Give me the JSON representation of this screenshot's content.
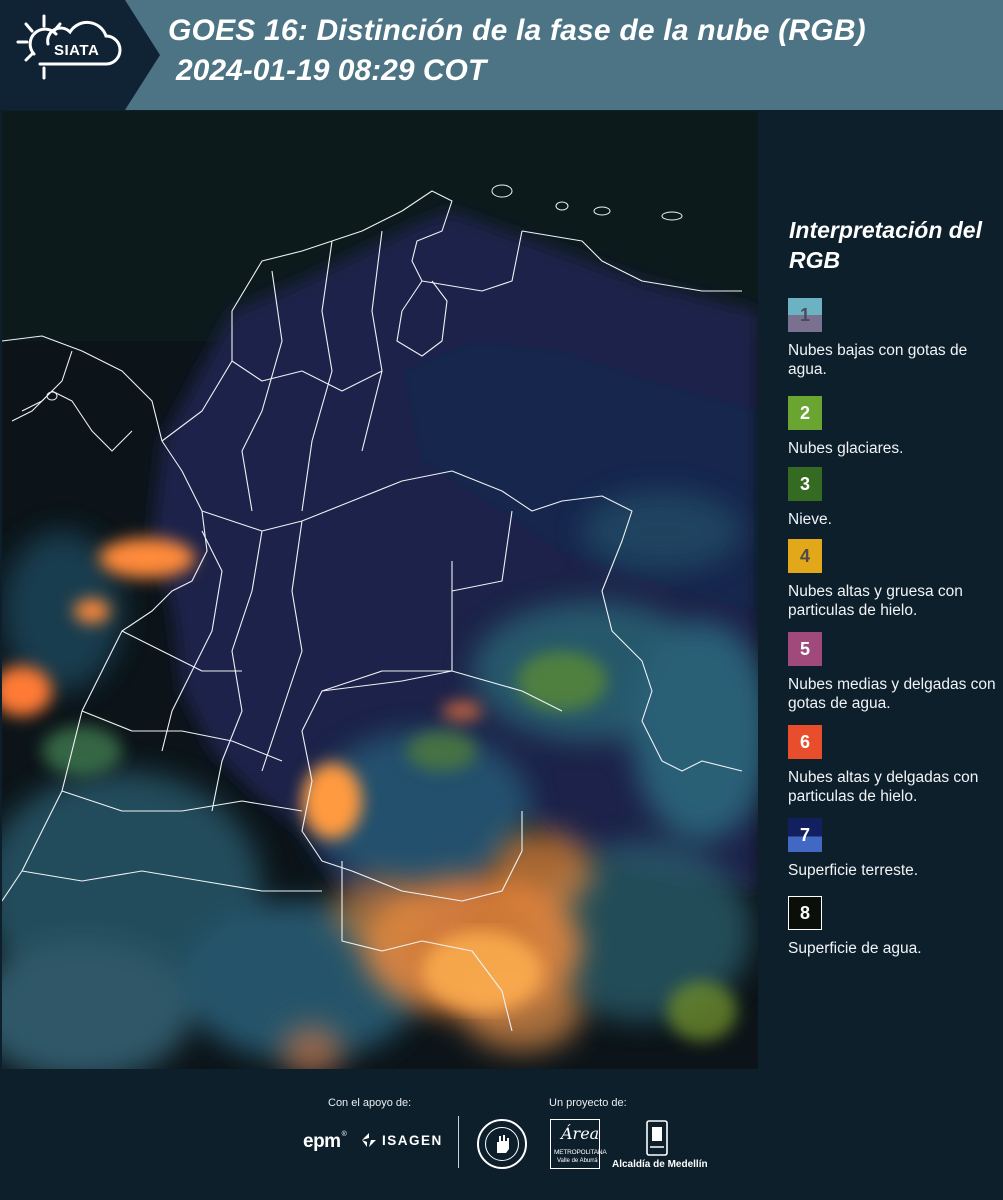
{
  "header": {
    "logo_text": "SIATA",
    "title_line1": "GOES 16: Distinción de la fase de la nube (RGB)",
    "title_line2": "2024-01-19 08:29 COT"
  },
  "legend": {
    "title": "Interpretación del RGB",
    "items": [
      {
        "number": "1",
        "label": "Nubes bajas con gotas de agua.",
        "color_top": "#6bb3c2",
        "color_bottom": "#7a7090",
        "text_color": "#4a4a5c"
      },
      {
        "number": "2",
        "label": "Nubes glaciares.",
        "color_top": "#6aa531",
        "color_bottom": "#6aa531",
        "text_color": "#ffffff"
      },
      {
        "number": "3",
        "label": "Nieve.",
        "color_top": "#356a22",
        "color_bottom": "#356a22",
        "text_color": "#ffffff"
      },
      {
        "number": "4",
        "label": "Nubes altas y gruesa con particulas de hielo.",
        "color_top": "#e3a819",
        "color_bottom": "#e3a819",
        "text_color": "#4a4a4a"
      },
      {
        "number": "5",
        "label": "Nubes medias y delgadas con gotas de agua.",
        "color_top": "#a04a7c",
        "color_bottom": "#a04a7c",
        "text_color": "#ffffff"
      },
      {
        "number": "6",
        "label": "Nubes altas y delgadas con particulas de hielo.",
        "color_top": "#e84e2c",
        "color_bottom": "#e84e2c",
        "text_color": "#ffffff"
      },
      {
        "number": "7",
        "label": "Superficie terreste.",
        "color_top": "#13205f",
        "color_bottom": "#4169c4",
        "text_color": "#ffffff"
      },
      {
        "number": "8",
        "label": "Superficie de agua.",
        "color_top": "#0a0f0a",
        "color_bottom": "#0a0f0a",
        "text_color": "#ffffff"
      }
    ]
  },
  "footer": {
    "support_label": "Con el apoyo de:",
    "project_label": "Un proyecto de:",
    "sponsor1": "epm",
    "sponsor2": "ISAGEN",
    "partner1": "METROPOLITANA",
    "partner1_sub": "Valle de Aburrá",
    "partner1_script": "Área",
    "partner2": "Alcaldía de Medellín"
  }
}
